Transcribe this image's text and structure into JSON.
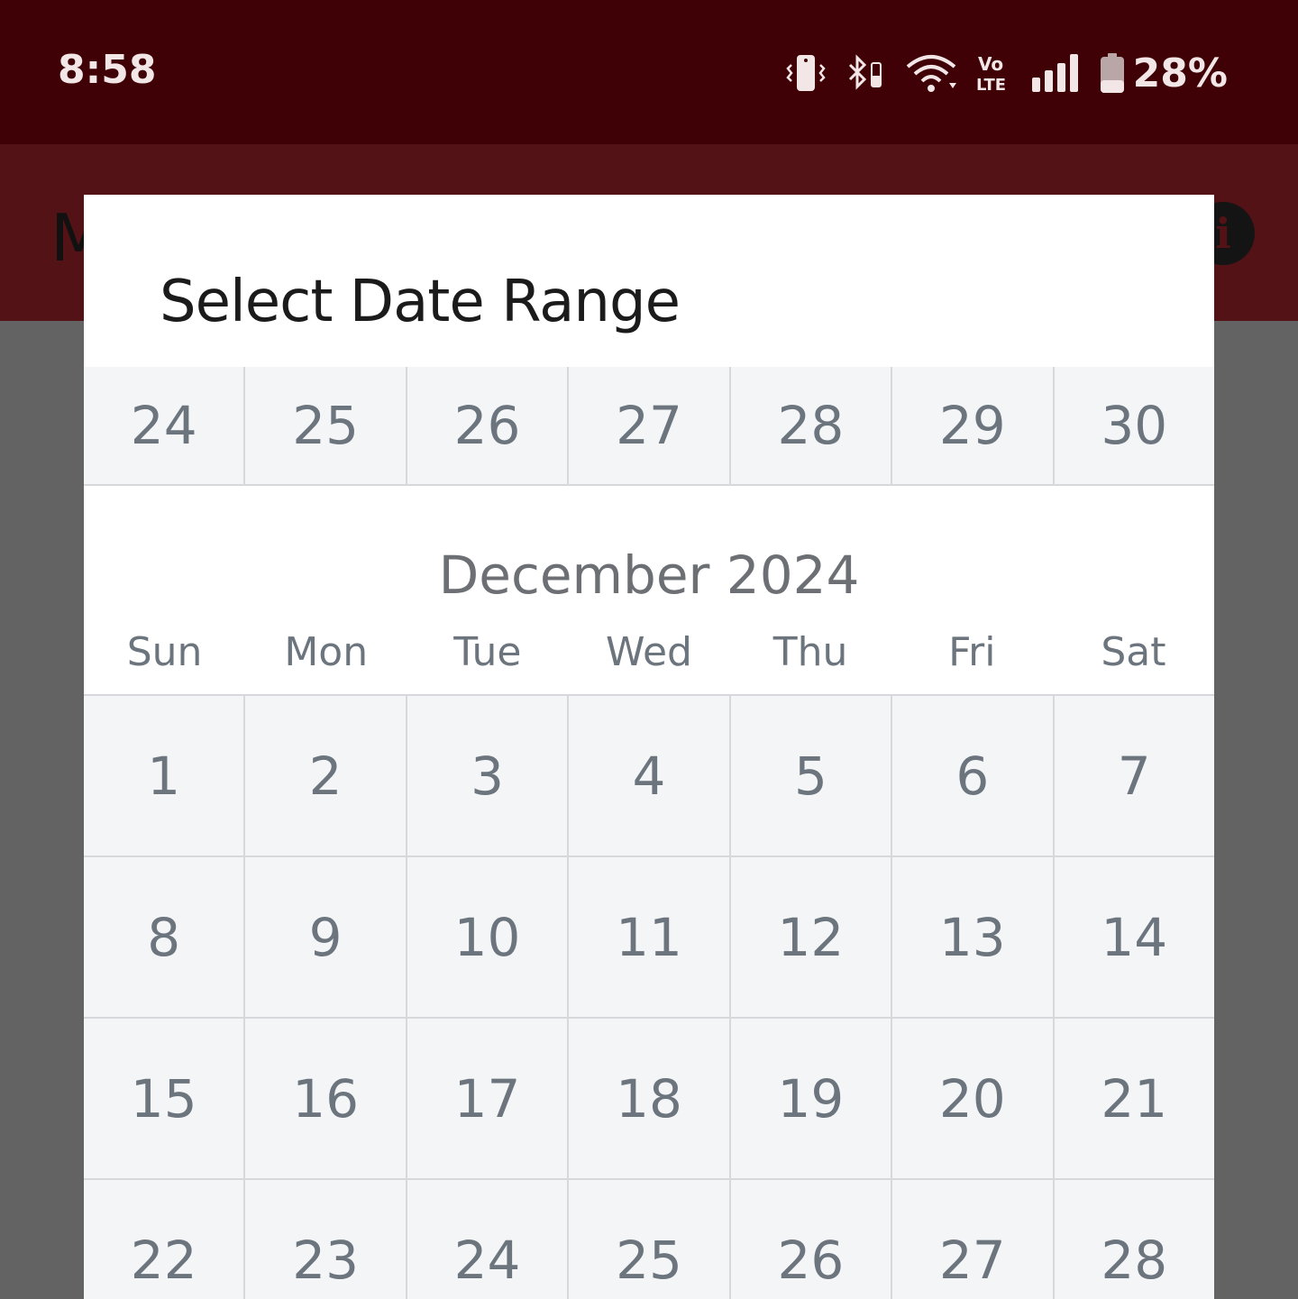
{
  "status_bar": {
    "time": "8:58",
    "battery_percent": "28%",
    "icons": [
      "vibrate-icon",
      "bluetooth-icon",
      "wifi-icon",
      "volte-icon",
      "signal-icon",
      "battery-icon"
    ]
  },
  "app_bar": {
    "title_fragment": "M",
    "info_icon_label": "i",
    "background": "#521216"
  },
  "dialog": {
    "title": "Select Date Range",
    "previous_month_last_row": [
      "24",
      "25",
      "26",
      "27",
      "28",
      "29",
      "30"
    ],
    "month_title": "December 2024",
    "weekdays": [
      "Sun",
      "Mon",
      "Tue",
      "Wed",
      "Thu",
      "Fri",
      "Sat"
    ],
    "weeks": [
      [
        "1",
        "2",
        "3",
        "4",
        "5",
        "6",
        "7"
      ],
      [
        "8",
        "9",
        "10",
        "11",
        "12",
        "13",
        "14"
      ],
      [
        "15",
        "16",
        "17",
        "18",
        "19",
        "20",
        "21"
      ],
      [
        "22",
        "23",
        "24",
        "25",
        "26",
        "27",
        "28"
      ]
    ]
  },
  "colors": {
    "status_bar": "#3f0006",
    "scrim": "#636363",
    "cell_background": "#f3f5f7",
    "cell_text": "#6c747d"
  }
}
